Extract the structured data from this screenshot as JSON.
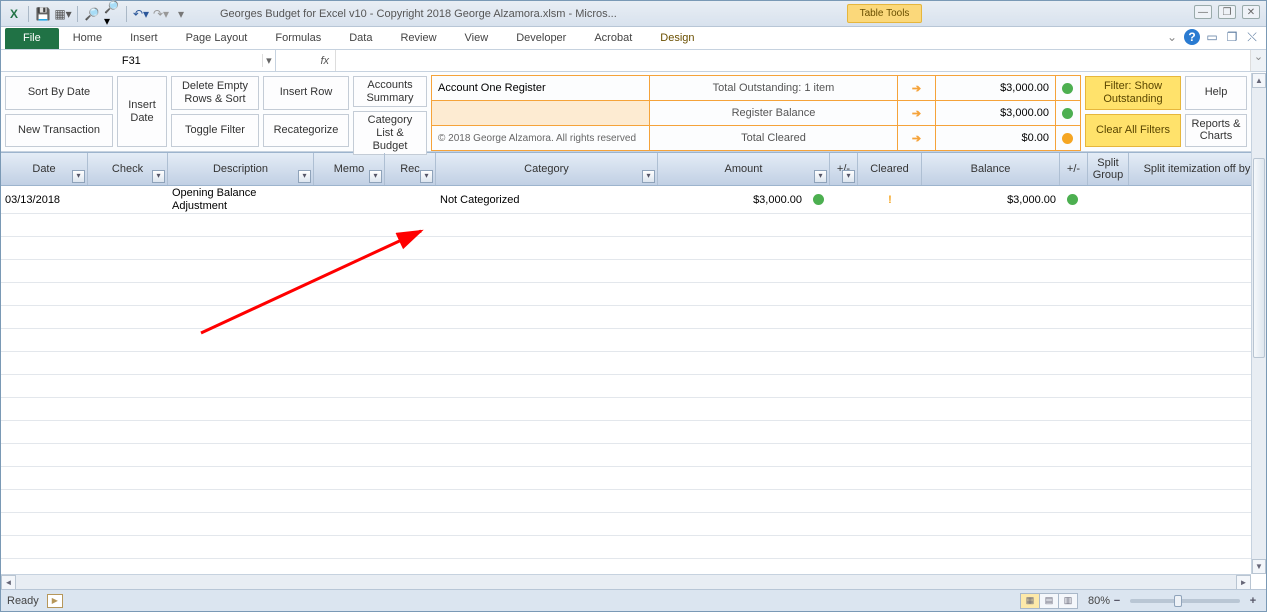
{
  "title": "Georges Budget for Excel v10 - Copyright 2018 George Alzamora.xlsm  -  Micros...",
  "table_tools_label": "Table Tools",
  "ribbon": {
    "file": "File",
    "tabs": [
      "Home",
      "Insert",
      "Page Layout",
      "Formulas",
      "Data",
      "Review",
      "View",
      "Developer",
      "Acrobat"
    ],
    "design": "Design"
  },
  "namebox": "F31",
  "fx": "fx",
  "toolbar": {
    "sort_by_date": "Sort By Date",
    "new_transaction": "New Transaction",
    "insert_date": "Insert Date",
    "delete_empty": "Delete Empty Rows & Sort",
    "toggle_filter": "Toggle Filter",
    "insert_row": "Insert Row",
    "recategorize": "Recategorize",
    "accounts_summary": "Accounts Summary",
    "category_list": "Category List & Budget",
    "filter_show": "Filter: Show Outstanding",
    "clear_filters": "Clear All Filters",
    "help": "Help",
    "reports": "Reports & Charts"
  },
  "summary": {
    "r1": {
      "label": "Account One Register",
      "mid": "Total Outstanding: 1 item",
      "val": "$3,000.00",
      "dot": "green"
    },
    "r2": {
      "label": "",
      "mid": "Register Balance",
      "val": "$3,000.00",
      "dot": "green"
    },
    "r3": {
      "label": "© 2018 George Alzamora. All rights reserved",
      "mid": "Total Cleared",
      "val": "$0.00",
      "dot": "orange"
    }
  },
  "headers": {
    "date": "Date",
    "check": "Check",
    "desc": "Description",
    "memo": "Memo",
    "rec": "Rec",
    "cat": "Category",
    "amt": "Amount",
    "pm": "+/-",
    "clr": "Cleared",
    "bal": "Balance",
    "pm2": "+/-",
    "grp": "Split Group",
    "split": "Split itemization off by"
  },
  "row": {
    "date": "03/13/2018",
    "desc": "Opening Balance Adjustment",
    "cat": "Not Categorized",
    "amt": "$3,000.00",
    "clr": "!",
    "bal": "$3,000.00"
  },
  "status": {
    "ready": "Ready",
    "zoom": "80%"
  }
}
